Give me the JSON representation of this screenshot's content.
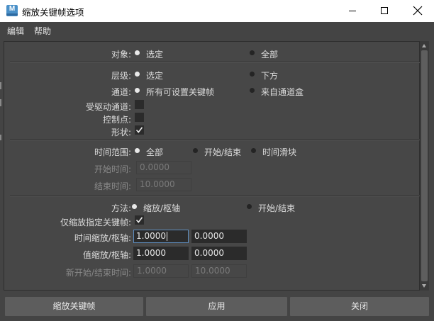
{
  "window": {
    "title": "缩放关键帧选项",
    "icon_letter": "M"
  },
  "menu": [
    "编辑",
    "帮助"
  ],
  "object": {
    "label": "对象:",
    "options": [
      "选定",
      "全部"
    ],
    "selected": 0
  },
  "hierarchy": {
    "label": "层级:",
    "options": [
      "选定",
      "下方"
    ],
    "selected": 0
  },
  "channels": {
    "label": "通道:",
    "options": [
      "所有可设置关键帧",
      "来自通道盒"
    ],
    "selected": 0
  },
  "driven_channels": {
    "label": "受驱动通道:",
    "checked": false
  },
  "control_points": {
    "label": "控制点:",
    "checked": false
  },
  "shapes": {
    "label": "形状:",
    "checked": true
  },
  "time_range": {
    "label": "时间范围:",
    "options": [
      "全部",
      "开始/结束",
      "时间滑块"
    ],
    "selected": 0
  },
  "start_time": {
    "label": "开始时间:",
    "value": "0.0000"
  },
  "end_time": {
    "label": "结束时间:",
    "value": "10.0000"
  },
  "method": {
    "label": "方法:",
    "options": [
      "缩放/枢轴",
      "开始/结束"
    ],
    "selected": 0
  },
  "scale_specified_keys": {
    "label": "仅缩放指定关键帧:",
    "checked": true
  },
  "time_scale_pivot": {
    "label": "时间缩放/枢轴:",
    "scale": "1.0000",
    "pivot": "0.0000"
  },
  "value_scale_pivot": {
    "label": "值缩放/枢轴:",
    "scale": "1.0000",
    "pivot": "0.0000"
  },
  "new_start_end": {
    "label": "新开始/结束时间:",
    "start": "1.0000",
    "end": "10.0000"
  },
  "buttons": {
    "scale": "缩放关键帧",
    "apply": "应用",
    "close": "关闭"
  },
  "colors": {
    "background": "#444444",
    "button": "#5d5d5d",
    "field": "#2b2b2b",
    "focus_border": "#5e8ec0"
  }
}
